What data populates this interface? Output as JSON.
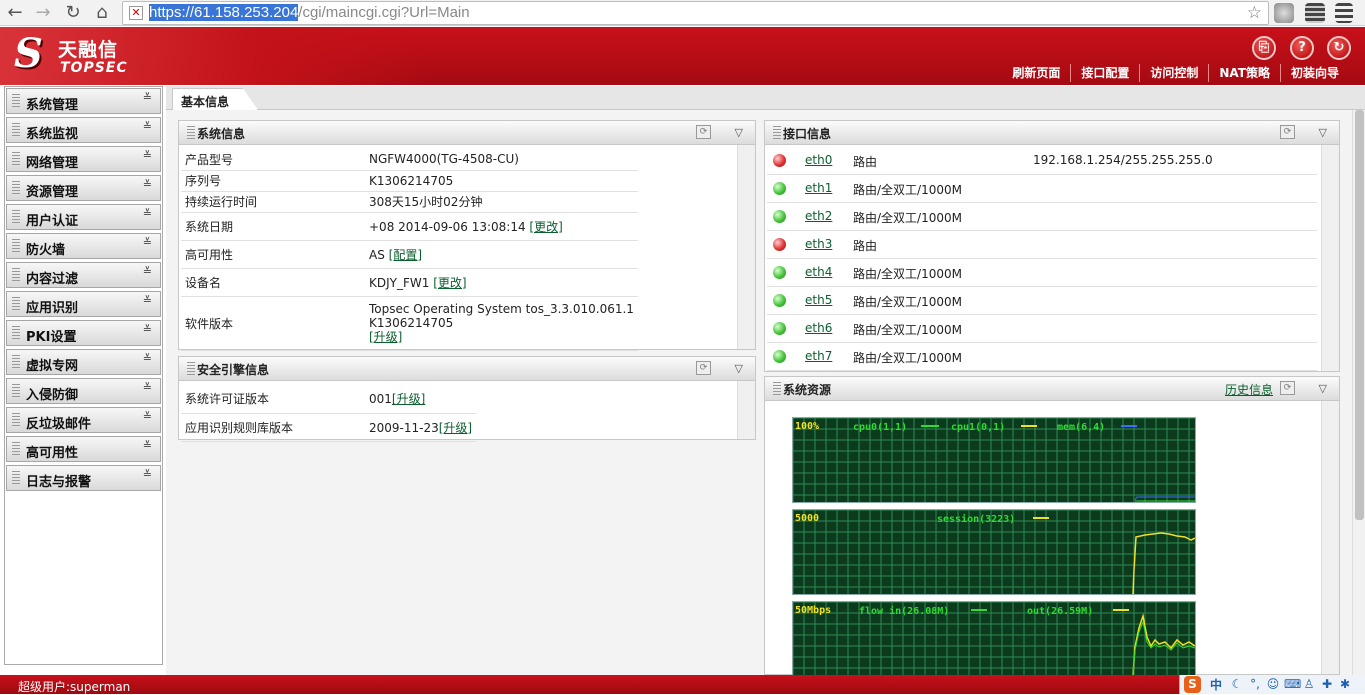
{
  "browser": {
    "url_selected": "https://61.158.253.204",
    "url_rest": "/cgi/maincgi.cgi?Url=Main",
    "back_icon": "←",
    "forward_icon": "→",
    "reload_icon": "↻",
    "home_icon": "⌂",
    "star_icon": "☆"
  },
  "header": {
    "logo_cn": "天融信",
    "logo_en": "TOPSEC",
    "logo_mark": "S",
    "nav": [
      "刷新页面",
      "接口配置",
      "访问控制",
      "NAT策略",
      "初装向导"
    ],
    "icons": {
      "save": "⎘",
      "help": "?",
      "logout": "↻"
    }
  },
  "sidebar": {
    "items": [
      "系统管理",
      "系统监视",
      "网络管理",
      "资源管理",
      "用户认证",
      "防火墙",
      "内容过滤",
      "应用识别",
      "PKI设置",
      "虚拟专网",
      "入侵防御",
      "反垃圾邮件",
      "高可用性",
      "日志与报警"
    ],
    "chevron": "≚"
  },
  "tab": {
    "label": "基本信息"
  },
  "system_info": {
    "title": "系统信息",
    "rows": [
      {
        "key": "产品型号",
        "value": "NGFW4000(TG-4508-CU)",
        "link": ""
      },
      {
        "key": "序列号",
        "value": "K1306214705",
        "link": ""
      },
      {
        "key": "持续运行时间",
        "value": "308天15小时02分钟",
        "link": ""
      },
      {
        "key": "系统日期",
        "value": "+08 2014-09-06 13:08:14",
        "link": "[更改]"
      },
      {
        "key": "高可用性",
        "value": "AS",
        "link": "[配置]"
      },
      {
        "key": "设备名",
        "value": "KDJY_FW1",
        "link": "[更改]"
      },
      {
        "key": "软件版本",
        "value": "Topsec Operating System tos_3.3.010.061.1",
        "value2": "K1306214705",
        "link": "[升级]"
      }
    ]
  },
  "engine_info": {
    "title": "安全引擎信息",
    "rows": [
      {
        "key": "系统许可证版本",
        "value": "001",
        "link": "[升级]"
      },
      {
        "key": "应用识别规则库版本",
        "value": "2009-11-23",
        "link": "[升级]"
      }
    ]
  },
  "interfaces": {
    "title": "接口信息",
    "rows": [
      {
        "name": "eth0",
        "status": "red",
        "mode": "路由",
        "ip": "192.168.1.254/255.255.255.0"
      },
      {
        "name": "eth1",
        "status": "green",
        "mode": "路由/全双工/1000M",
        "ip": ""
      },
      {
        "name": "eth2",
        "status": "green",
        "mode": "路由/全双工/1000M",
        "ip": ""
      },
      {
        "name": "eth3",
        "status": "red",
        "mode": "路由",
        "ip": ""
      },
      {
        "name": "eth4",
        "status": "green",
        "mode": "路由/全双工/1000M",
        "ip": ""
      },
      {
        "name": "eth5",
        "status": "green",
        "mode": "路由/全双工/1000M",
        "ip": ""
      },
      {
        "name": "eth6",
        "status": "green",
        "mode": "路由/全双工/1000M",
        "ip": ""
      },
      {
        "name": "eth7",
        "status": "green",
        "mode": "路由/全双工/1000M",
        "ip": ""
      }
    ]
  },
  "resources": {
    "title": "系统资源",
    "history": "历史信息",
    "graphs": [
      {
        "max": "100%",
        "legend": [
          "cpu0(1,1)",
          "cpu1(0,1)",
          "mem(6,4)"
        ],
        "colors": [
          "#2fdc2f",
          "#f0e020",
          "#3a6cff"
        ]
      },
      {
        "max": "5000",
        "legend": [
          "session(3223)"
        ],
        "colors": [
          "#f0e020"
        ]
      },
      {
        "max": "50Mbps",
        "legend": [
          "flow in(26.08M)",
          "out(26.59M)"
        ],
        "colors": [
          "#2fdc2f",
          "#f0e020"
        ]
      }
    ]
  },
  "status": {
    "text": "超级用户:superman",
    "ime": "中"
  },
  "colors": {
    "brand_red": "#c8101a",
    "link_green": "#0a5f2d",
    "graph_bg": "#0b3a1d"
  }
}
